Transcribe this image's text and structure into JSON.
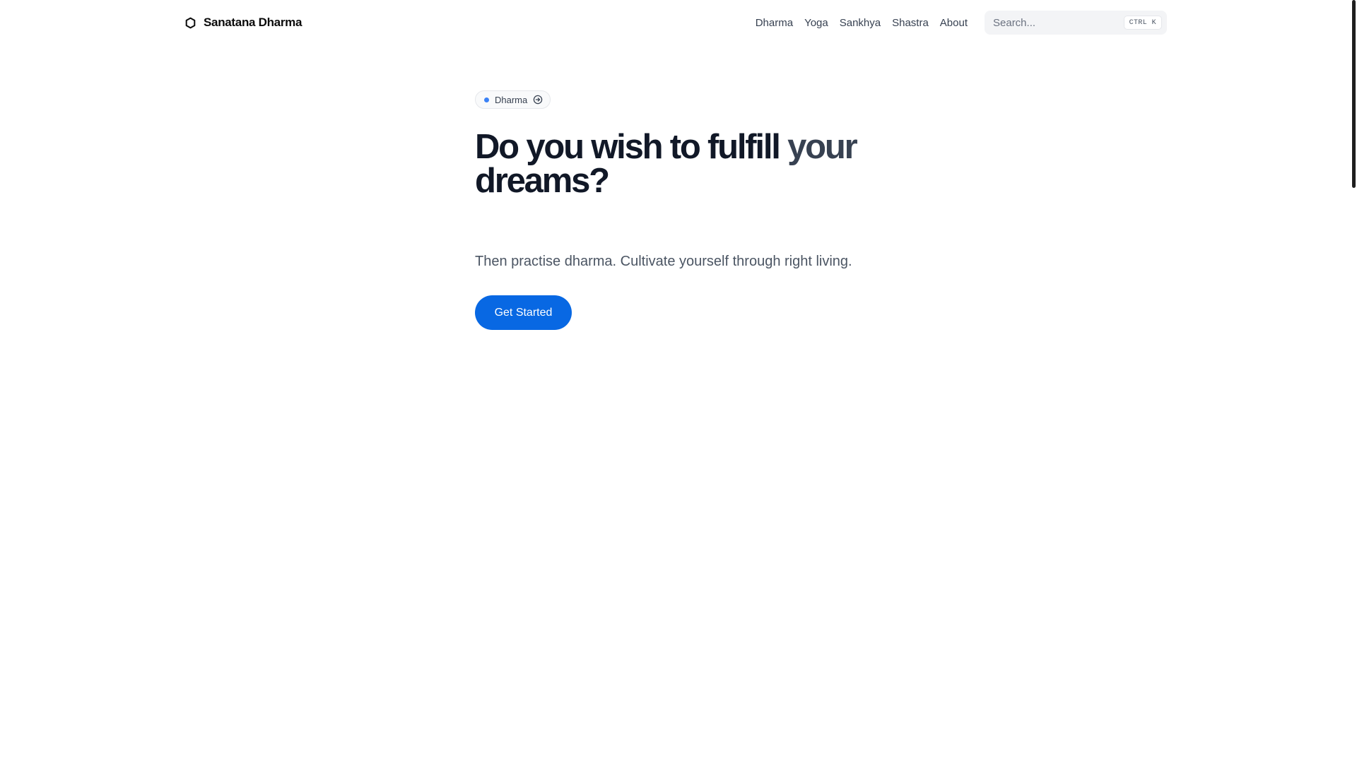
{
  "header": {
    "brand": {
      "name": "Sanatana Dharma",
      "icon": "circle-logo-icon"
    },
    "nav": [
      {
        "label": "Dharma"
      },
      {
        "label": "Yoga"
      },
      {
        "label": "Sankhya"
      },
      {
        "label": "Shastra"
      },
      {
        "label": "About"
      }
    ],
    "search": {
      "placeholder": "Search...",
      "value": "",
      "shortcut": "CTRL K"
    }
  },
  "hero": {
    "tag": {
      "label": "Dharma",
      "dot_color": "#3b82f6",
      "icon": "arrow-right-circle-icon"
    },
    "title_main": "Do you wish to fulfill",
    "title_accent": " your",
    "title_line2": "dreams?",
    "subtitle": "Then practise dharma. Cultivate yourself through right living.",
    "cta_label": "Get Started"
  },
  "colors": {
    "accent": "#0868e3",
    "heading": "#111827",
    "body_text": "#4b5563"
  }
}
